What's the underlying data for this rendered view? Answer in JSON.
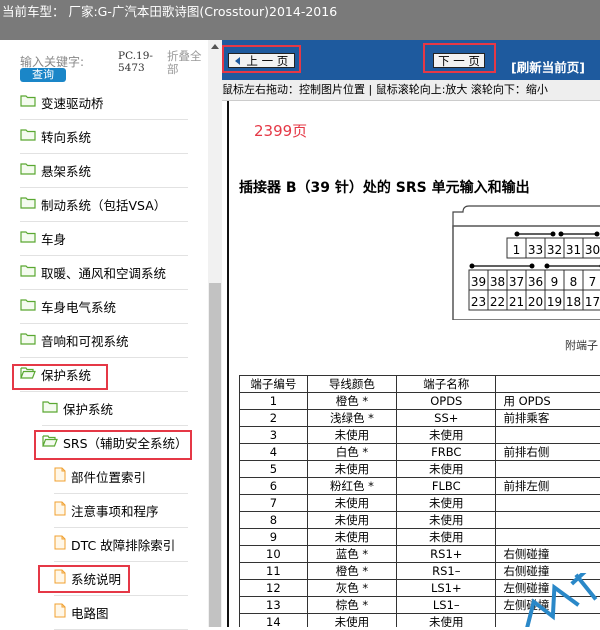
{
  "header": {
    "title": "当前车型：  厂家:G-广汽本田歌诗图(Crosstour)2014-2016"
  },
  "search": {
    "label": "输入关键字:",
    "button": "查询",
    "pc_label": "PC.19-5473",
    "fold_all": "折叠全部"
  },
  "tree": [
    {
      "label": "变速驱动桥",
      "icon": "folder-icon"
    },
    {
      "label": "转向系统",
      "icon": "folder-icon"
    },
    {
      "label": "悬架系统",
      "icon": "folder-icon"
    },
    {
      "label": "制动系统（包括VSA）",
      "icon": "folder-icon"
    },
    {
      "label": "车身",
      "icon": "folder-icon"
    },
    {
      "label": "取暖、通风和空调系统",
      "icon": "folder-icon"
    },
    {
      "label": "车身电气系统",
      "icon": "folder-icon"
    },
    {
      "label": "音响和可视系统",
      "icon": "folder-icon"
    },
    {
      "label": "保护系统",
      "icon": "folder-open-icon"
    },
    {
      "label": "保护系统",
      "icon": "folder-icon"
    },
    {
      "label": "SRS（辅助安全系统）",
      "icon": "folder-open-icon"
    },
    {
      "label": "部件位置索引",
      "icon": "document-icon"
    },
    {
      "label": "注意事项和程序",
      "icon": "document-icon"
    },
    {
      "label": "DTC 故障排除索引",
      "icon": "document-icon"
    },
    {
      "label": "系统说明",
      "icon": "document-icon"
    },
    {
      "label": "电路图",
      "icon": "document-icon"
    }
  ],
  "toolbar": {
    "prev": "上 一 页",
    "next": "下 一 页",
    "refresh": "[刷新当前页]"
  },
  "hint": "鼠标左右拖动：控制图片位置 | 鼠标滚轮向上:放大  滚轮向下：缩小",
  "document": {
    "page_number": "2399页",
    "title": "插接器 B（39 针）处的 SRS 单元输入和输出",
    "connector_top": [
      "1",
      "33",
      "32",
      "31",
      "30"
    ],
    "connector_mid": [
      "39",
      "38",
      "37",
      "36",
      "9",
      "8",
      "7"
    ],
    "connector_bot": [
      "23",
      "22",
      "21",
      "20",
      "19",
      "18",
      "17"
    ],
    "pin_note": "附端子",
    "table_headers": [
      "端子编号",
      "导线颜色",
      "端子名称",
      ""
    ],
    "rows": [
      [
        "1",
        "橙色 *",
        "OPDS",
        "用 OPDS"
      ],
      [
        "2",
        "浅绿色 *",
        "SS+",
        "前排乘客"
      ],
      [
        "3",
        "未使用",
        "未使用",
        ""
      ],
      [
        "4",
        "白色 *",
        "FRBC",
        "前排右侧"
      ],
      [
        "5",
        "未使用",
        "未使用",
        ""
      ],
      [
        "6",
        "粉红色 *",
        "FLBC",
        "前排左侧"
      ],
      [
        "7",
        "未使用",
        "未使用",
        ""
      ],
      [
        "8",
        "未使用",
        "未使用",
        ""
      ],
      [
        "9",
        "未使用",
        "未使用",
        ""
      ],
      [
        "10",
        "蓝色 *",
        "RS1+",
        "右侧碰撞"
      ],
      [
        "11",
        "橙色 *",
        "RS1–",
        "右侧碰撞"
      ],
      [
        "12",
        "灰色 *",
        "LS1+",
        "左侧碰撞"
      ],
      [
        "13",
        "棕色 *",
        "LS1–",
        "左侧碰撞"
      ],
      [
        "14",
        "未使用",
        "未使用",
        ""
      ]
    ]
  },
  "colors": {
    "accent_red": "#e53846",
    "toolbar_blue": "#1e5a9e",
    "search_blue": "#1a86c8",
    "titlebar_gray": "#7a7a7a"
  }
}
